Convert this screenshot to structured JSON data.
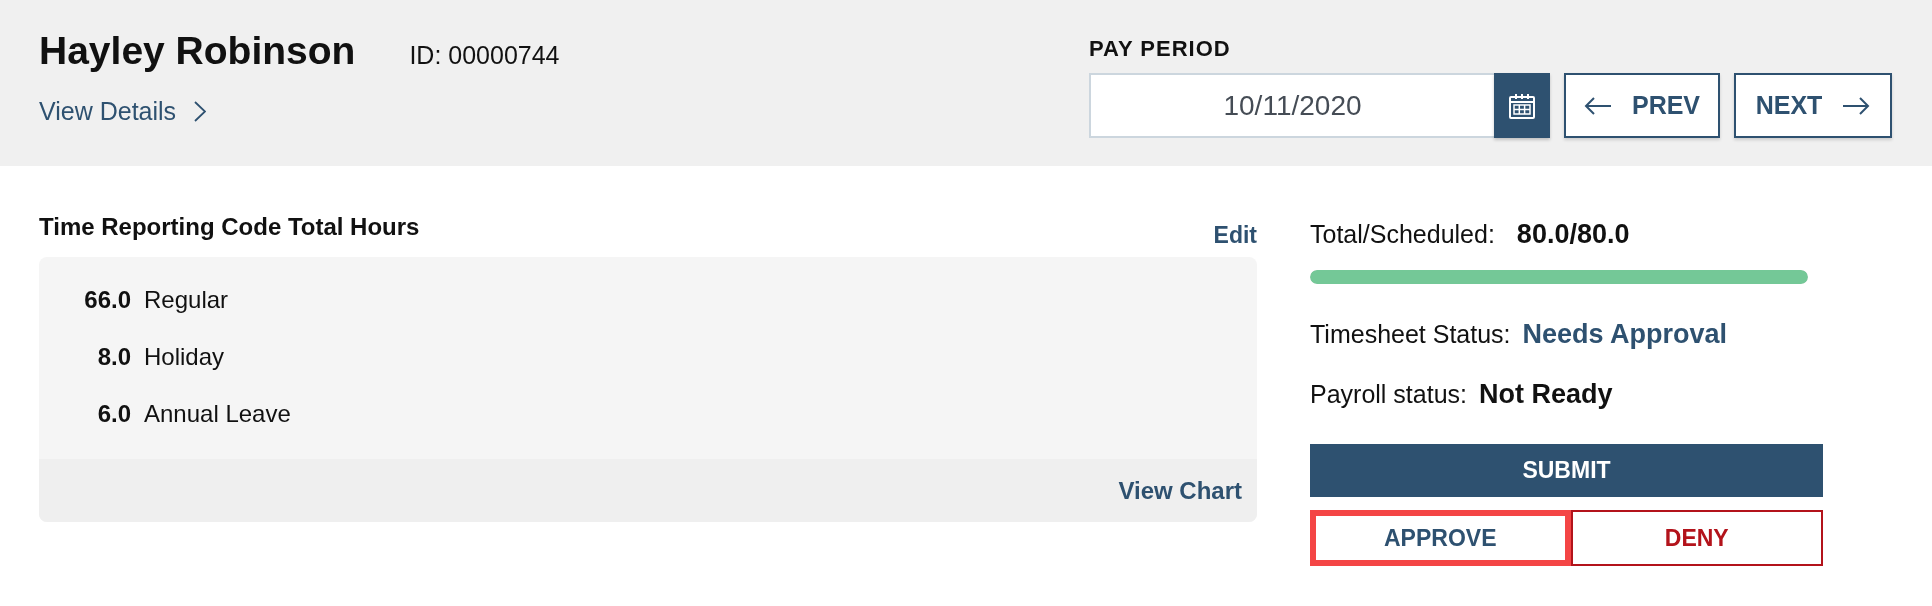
{
  "employee": {
    "name": "Hayley Robinson",
    "id_text": "ID: 00000744",
    "details_link": "View Details"
  },
  "pay_period": {
    "label": "PAY PERIOD",
    "date": "10/11/2020",
    "prev_label": "PREV",
    "next_label": "NEXT"
  },
  "time_codes": {
    "title": "Time Reporting Code Total Hours",
    "edit_link": "Edit",
    "rows": [
      {
        "hours": "66.0",
        "code": "Regular"
      },
      {
        "hours": "8.0",
        "code": "Holiday"
      },
      {
        "hours": "6.0",
        "code": "Annual Leave"
      }
    ],
    "footer_link": "View Chart"
  },
  "summary": {
    "total_label": "Total/Scheduled:",
    "total_value": "80.0/80.0",
    "progress": {
      "level": 1
    },
    "statuses": [
      {
        "label": "Timesheet Status:",
        "value": "Needs Approval",
        "kind": "accent"
      },
      {
        "label": "Payroll status:",
        "value": "Not Ready",
        "kind": "plain"
      }
    ]
  },
  "actions": [
    {
      "label": "SUBMIT",
      "kind": "primary",
      "focused": false
    },
    {
      "label": "APPROVE",
      "kind": "outline",
      "focused": true
    },
    {
      "label": "DENY",
      "kind": "danger",
      "focused": false
    }
  ]
}
